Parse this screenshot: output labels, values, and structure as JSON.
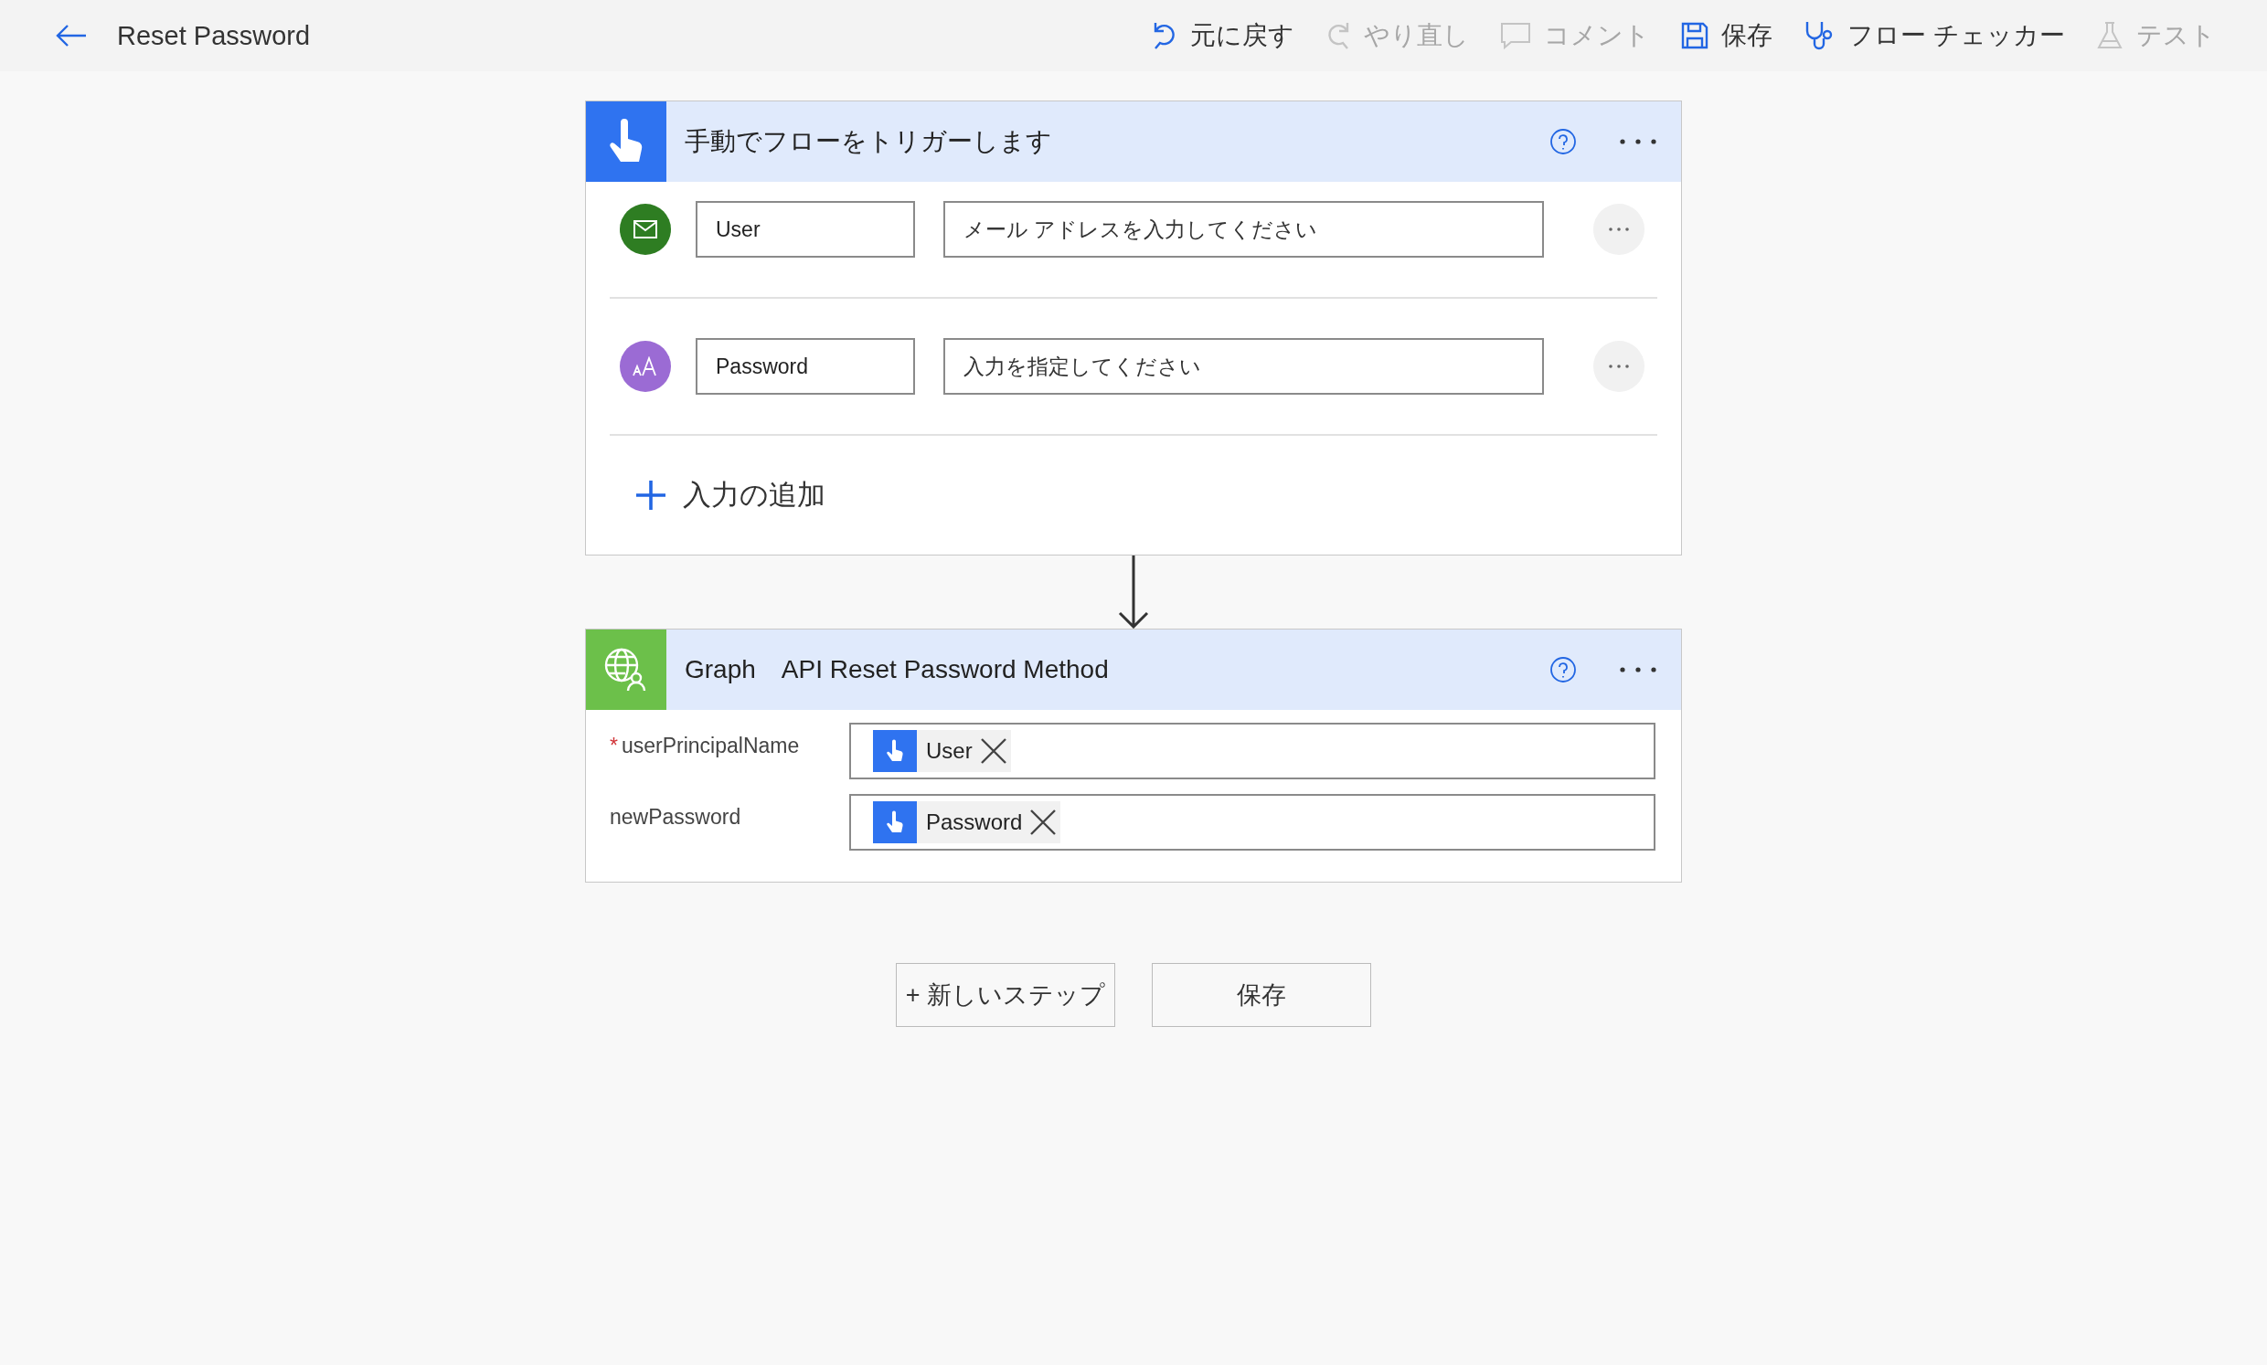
{
  "header": {
    "title": "Reset Password"
  },
  "toolbar": [
    {
      "kind": "undo",
      "label": "元に戻す",
      "disabled": false
    },
    {
      "kind": "redo",
      "label": "やり直し",
      "disabled": true
    },
    {
      "kind": "comment",
      "label": "コメント",
      "disabled": true
    },
    {
      "kind": "save",
      "label": "保存",
      "disabled": false
    },
    {
      "kind": "checker",
      "label": "フロー チェッカー",
      "disabled": false
    },
    {
      "kind": "test",
      "label": "テスト",
      "disabled": true
    }
  ],
  "trigger_card": {
    "title": "手動でフローをトリガーします",
    "inputs": [
      {
        "kind": "email",
        "name": "User",
        "placeholder": "メール アドレスを入力してください"
      },
      {
        "kind": "text",
        "name": "Password",
        "placeholder": "入力を指定してください"
      }
    ],
    "add_input": "入力の追加"
  },
  "action_card": {
    "title": "Graph　API Reset Password Method",
    "params": [
      {
        "required_mark": "*",
        "label": "userPrincipalName",
        "token": "User"
      },
      {
        "label": "newPassword",
        "token": "Password"
      }
    ]
  },
  "buttons": [
    {
      "label": "+ 新しいステップ"
    },
    {
      "label": "保存"
    }
  ]
}
